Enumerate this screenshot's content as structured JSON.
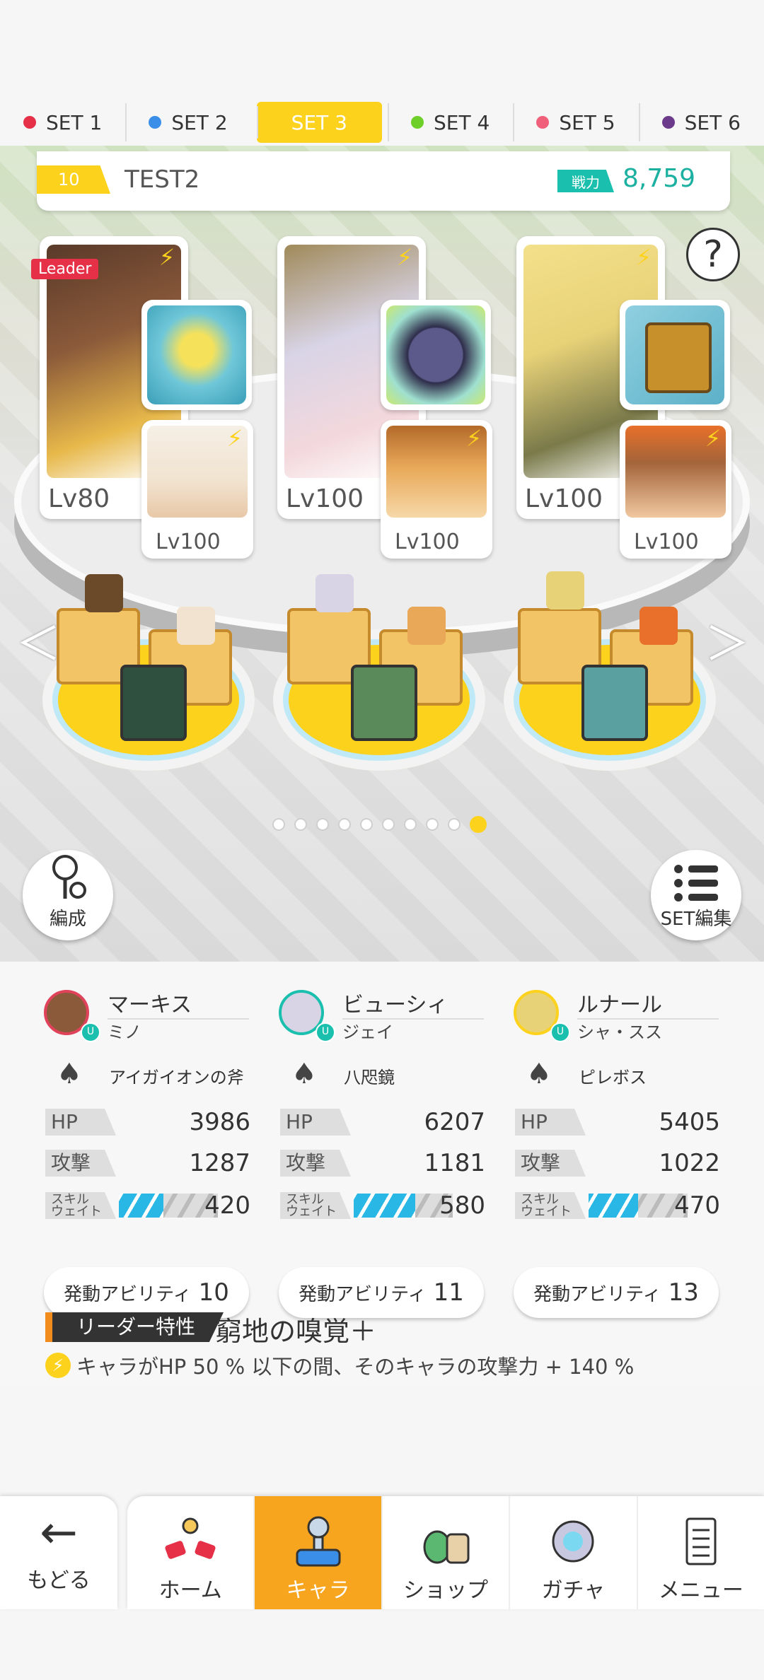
{
  "sets": [
    {
      "label": "SET 1",
      "color": "#e53047"
    },
    {
      "label": "SET 2",
      "color": "#3a8ee8"
    },
    {
      "label": "SET 3",
      "color": "#fcd21c",
      "active": true
    },
    {
      "label": "SET 4",
      "color": "#6fcf2a"
    },
    {
      "label": "SET 5",
      "color": "#f0607a"
    },
    {
      "label": "SET 6",
      "color": "#6b3a8a"
    }
  ],
  "team": {
    "number": "10",
    "name": "TEST2",
    "power_label": "戦力",
    "power_value": "8,759"
  },
  "leader_tag": "Leader",
  "help_symbol": "?",
  "arrows": {
    "left": "＜",
    "right": "＞"
  },
  "bolt": "⚡",
  "slots": [
    {
      "main_lv": "Lv80",
      "sub_lv": "Lv100",
      "main_color": "#8b5a3a",
      "item_color": "#6fc7d8",
      "sub_color": "#f1e3d0"
    },
    {
      "main_lv": "Lv100",
      "sub_lv": "Lv100",
      "main_color": "#d8d4e6",
      "item_color": "#5c5a8a",
      "sub_color": "#e8a858"
    },
    {
      "main_lv": "Lv100",
      "sub_lv": "Lv100",
      "main_color": "#e8d278",
      "item_color": "#c8902a",
      "sub_color": "#a4643a"
    }
  ],
  "pager": {
    "count": 10,
    "active": 9
  },
  "buttons": {
    "formation": "編成",
    "set_edit": "SET編集"
  },
  "characters": [
    {
      "name": "マーキス",
      "sub": "ミノ",
      "weapon": "アイガイオンの斧",
      "hp": "3986",
      "atk": "1287",
      "skill": "420",
      "skill_fill": 0.45,
      "ability_label": "発動アビリティ",
      "ability": "10",
      "avatar_color": "#8b5a3a",
      "border": "#e0425a"
    },
    {
      "name": "ビューシィ",
      "sub": "ジェイ",
      "weapon": "八咫鏡",
      "hp": "6207",
      "atk": "1181",
      "skill": "580",
      "skill_fill": 0.62,
      "ability_label": "発動アビリティ",
      "ability": "11",
      "avatar_color": "#d8d4e6",
      "border": "#1bbfad"
    },
    {
      "name": "ルナール",
      "sub": "シャ・スス",
      "weapon": "ピレボス",
      "hp": "5405",
      "atk": "1022",
      "skill": "470",
      "skill_fill": 0.5,
      "ability_label": "発動アビリティ",
      "ability": "13",
      "avatar_color": "#e8d278",
      "border": "#fcd21c"
    }
  ],
  "labels": {
    "hp": "HP",
    "atk": "攻撃",
    "skill_1": "スキル",
    "skill_2": "ウェイト"
  },
  "leader": {
    "tag": "リーダー特性",
    "name": "窮地の嗅覚＋",
    "desc": "キャラがHP 50 % 以下の間、そのキャラの攻撃力 + 140 %"
  },
  "nav": {
    "back": "もどる",
    "home": "ホーム",
    "chara": "キャラ",
    "shop": "ショップ",
    "gacha": "ガチャ",
    "menu": "メニュー",
    "back_icon": "←"
  }
}
